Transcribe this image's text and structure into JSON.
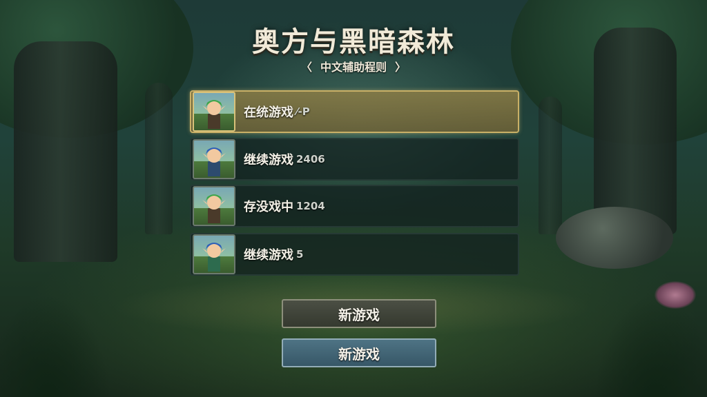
{
  "title": "奥方与黑暗森林",
  "subtitle": {
    "left_bracket": "〈",
    "text": "中文辅助程则",
    "right_bracket": "〉"
  },
  "save_slots": [
    {
      "label": "在统游戏",
      "number": "⁄-P",
      "selected": true,
      "hair_color": "#3fa64a"
    },
    {
      "label": "继续游戏",
      "number": "2406",
      "selected": false,
      "hair_color": "#2f5fb8"
    },
    {
      "label": "存没戏中",
      "number": "1204",
      "selected": false,
      "hair_color": "#3fa64a"
    },
    {
      "label": "继续游戏",
      "number": "5",
      "selected": false,
      "hair_color": "#2f5fb8"
    }
  ],
  "buttons": {
    "new_game_1": "新游戏",
    "new_game_2": "新游戏"
  },
  "colors": {
    "selected_slot": "#8c7d46",
    "button_blue": "#4e7384",
    "button_dark": "#4b4f44"
  }
}
